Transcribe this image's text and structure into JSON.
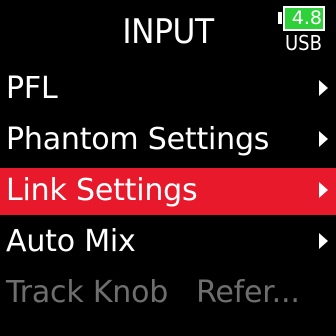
{
  "header": {
    "title": "INPUT",
    "battery": {
      "voltage": "4.8",
      "source": "USB",
      "color": "#2fd13a"
    }
  },
  "menu": {
    "items": [
      {
        "label": "PFL"
      },
      {
        "label": "Phantom Settings"
      },
      {
        "label": "Link Settings"
      },
      {
        "label": "Auto Mix"
      },
      {
        "label": "Track Knob   Refer..."
      }
    ],
    "selected_index": 2,
    "selected_color": "#e8192b"
  }
}
